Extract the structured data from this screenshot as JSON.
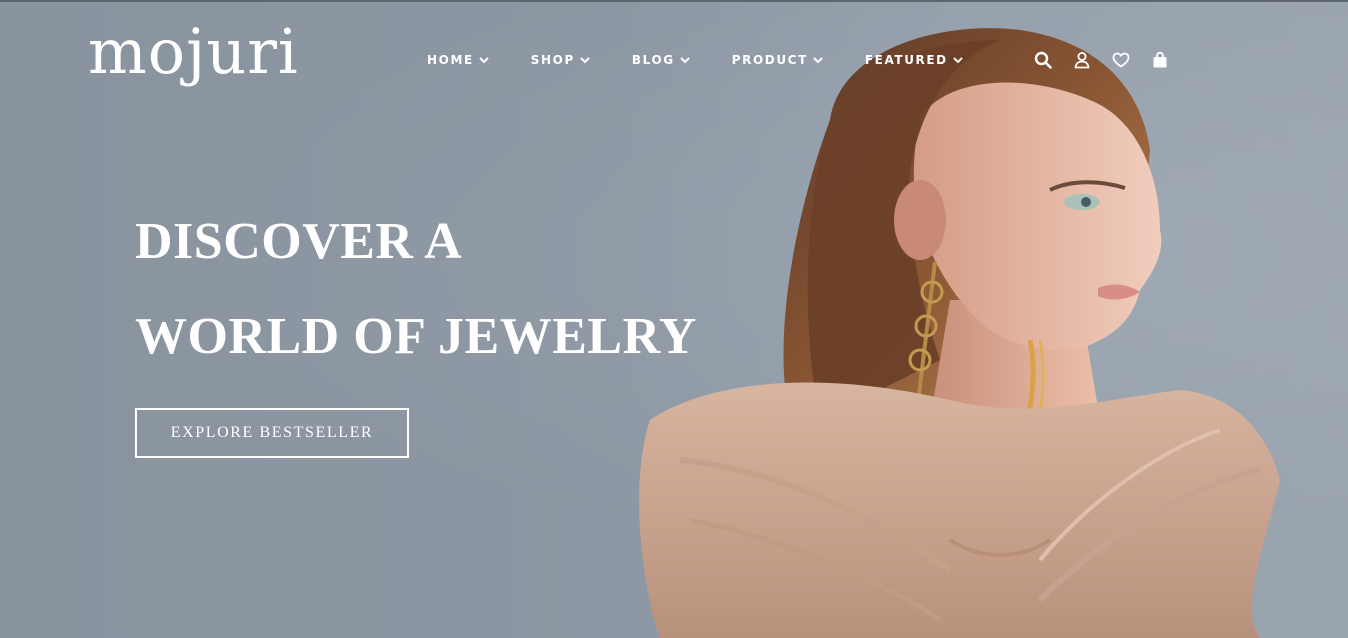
{
  "brand": {
    "logo_text": "mojuri"
  },
  "nav": {
    "items": [
      {
        "label": "HOME"
      },
      {
        "label": "SHOP"
      },
      {
        "label": "BLOG"
      },
      {
        "label": "PRODUCT"
      },
      {
        "label": "FEATURED"
      }
    ]
  },
  "header_icons": [
    "search-icon",
    "user-icon",
    "heart-icon",
    "shopping-bag-icon"
  ],
  "hero": {
    "headline_line1": "DISCOVER A",
    "headline_line2": "WORLD OF JEWELRY",
    "cta_label": "EXPLORE BESTSELLER"
  },
  "colors": {
    "background": "#8c97a3",
    "text": "#ffffff",
    "skin": "#e7b8a4",
    "fabric": "#d9b8a4",
    "hair": "#7a4a2e"
  }
}
